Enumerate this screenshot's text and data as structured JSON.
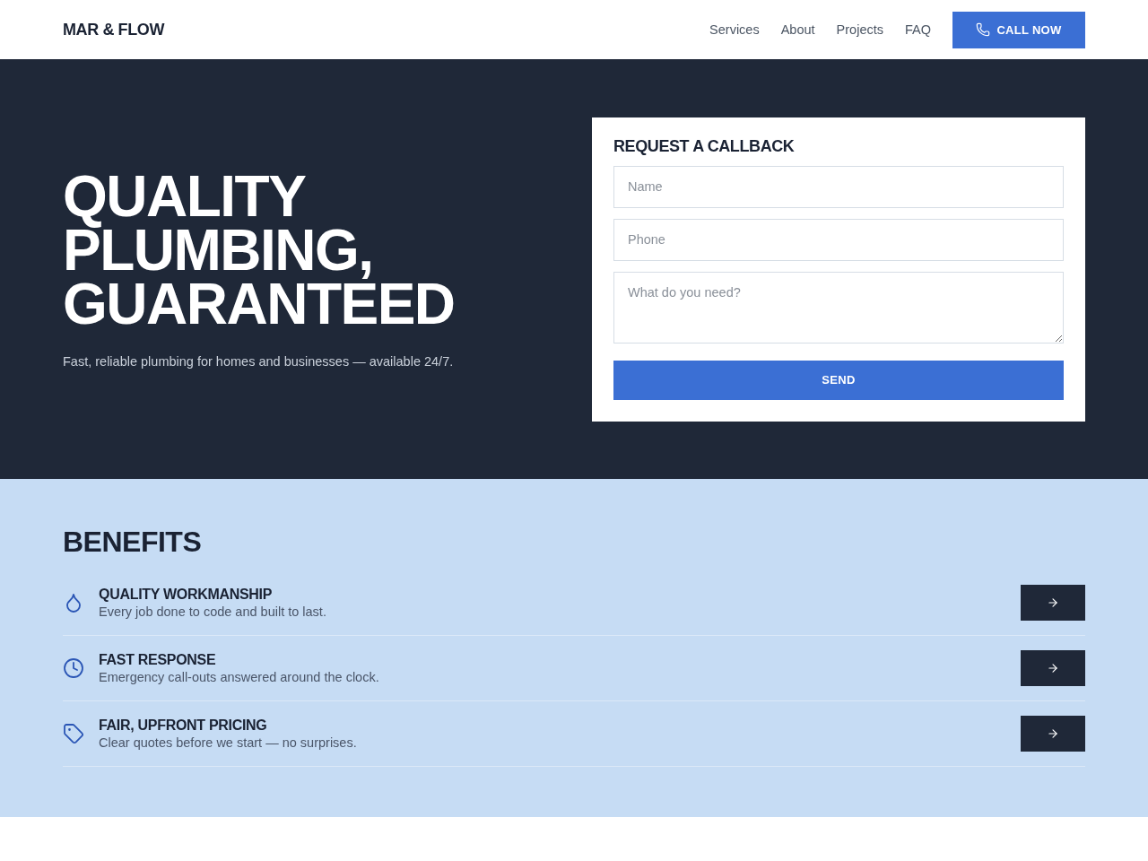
{
  "header": {
    "logo": "MAR & FLOW",
    "nav": [
      "Services",
      "About",
      "Projects",
      "FAQ"
    ],
    "cta": "CALL NOW"
  },
  "hero": {
    "title": "QUALITY PLUMBING, GUARANTEED",
    "subtitle": "Fast, reliable plumbing for homes and businesses — available 24/7."
  },
  "callback_form": {
    "title": "REQUEST A CALLBACK",
    "fields": [
      {
        "kind": "input",
        "placeholder": "Name"
      },
      {
        "kind": "input",
        "placeholder": "Phone"
      },
      {
        "kind": "textarea",
        "placeholder": "What do you need?"
      }
    ],
    "submit": "SEND"
  },
  "benefits": {
    "title": "BENEFITS",
    "items": [
      {
        "title": "QUALITY WORKMANSHIP",
        "description": "Every job done to code and built to last."
      },
      {
        "title": "FAST RESPONSE",
        "description": "Emergency call-outs answered around the clock."
      },
      {
        "title": "FAIR, UPFRONT PRICING",
        "description": "Clear quotes before we start — no surprises."
      }
    ]
  }
}
